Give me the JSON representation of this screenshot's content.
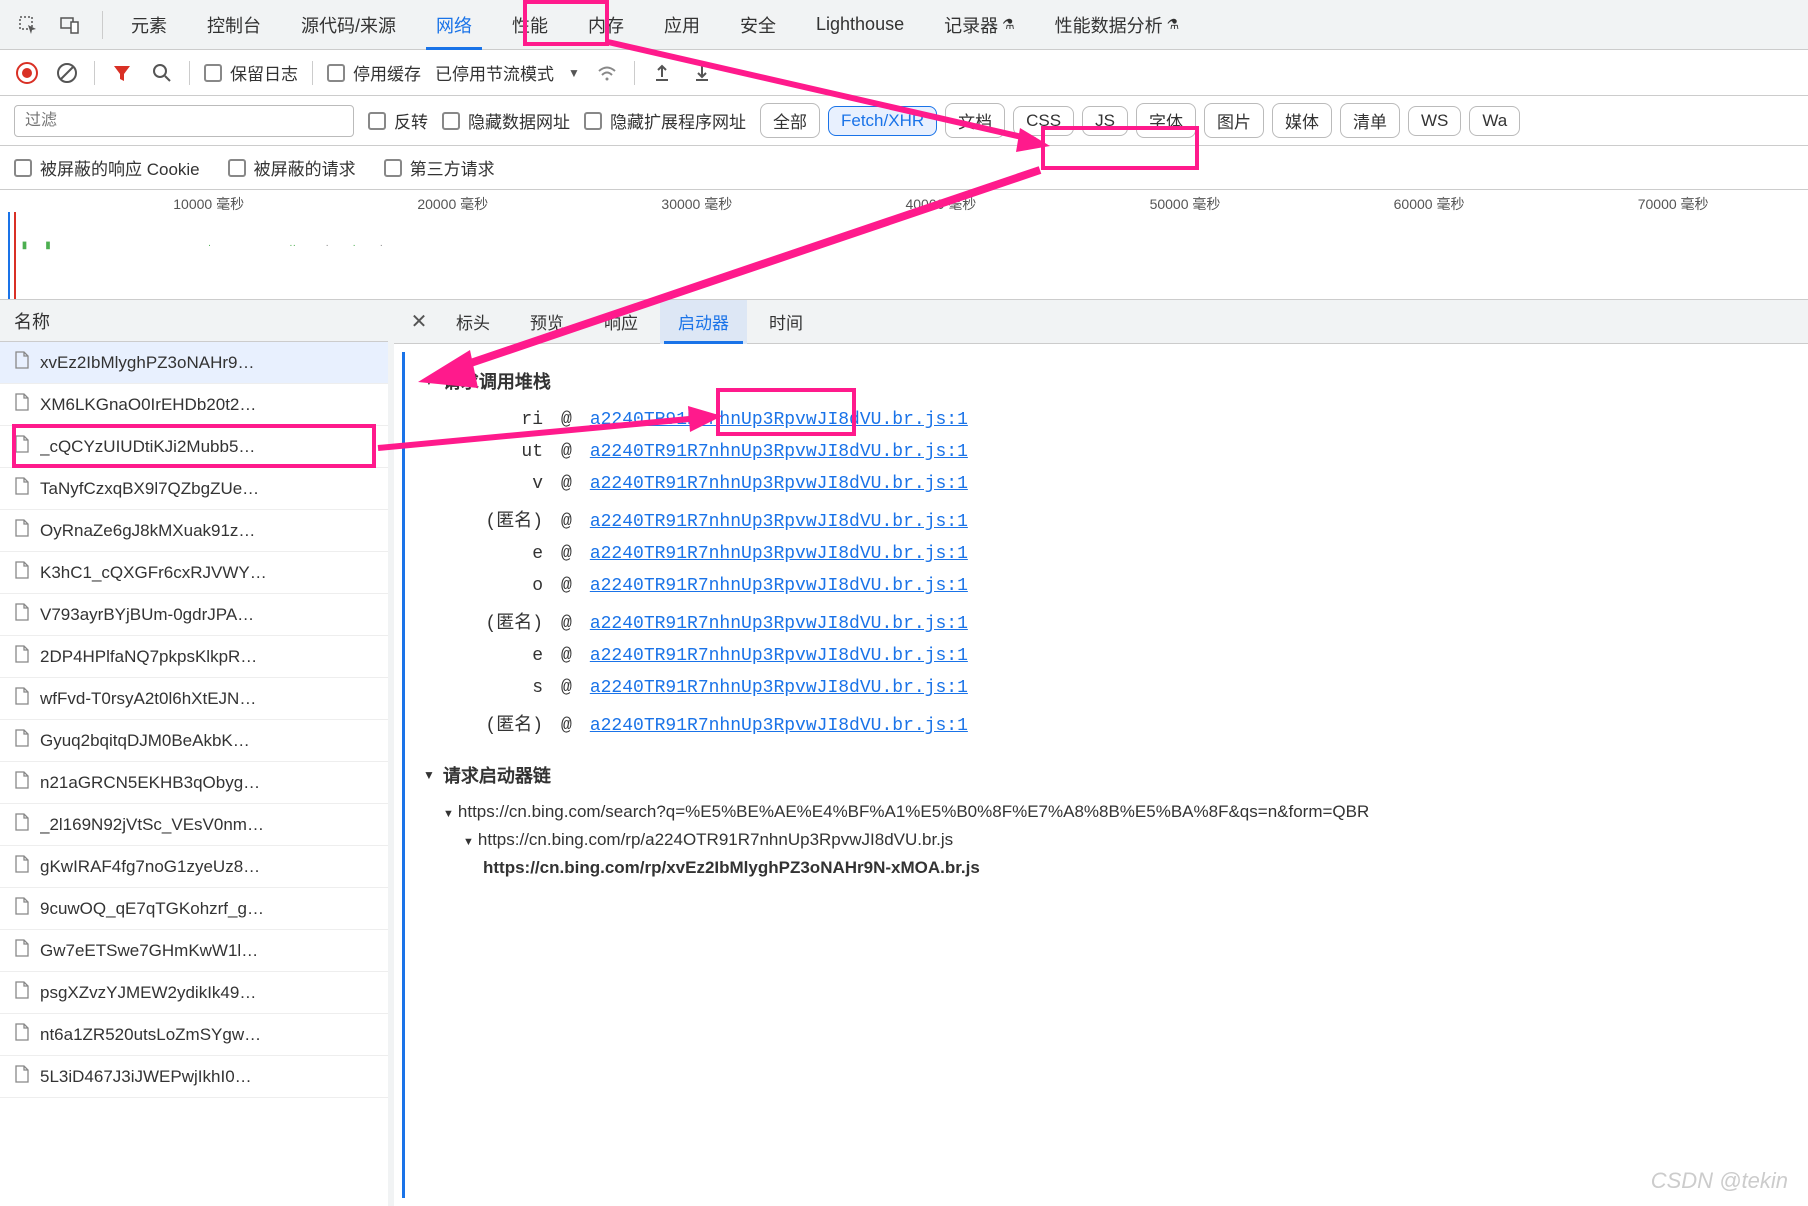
{
  "topTabs": {
    "items": [
      "元素",
      "控制台",
      "源代码/来源",
      "网络",
      "性能",
      "内存",
      "应用",
      "安全",
      "Lighthouse",
      "记录器",
      "性能数据分析"
    ],
    "activeIndex": 3,
    "betaIndices": [
      9,
      10
    ]
  },
  "toolbar2": {
    "preserveLog": "保留日志",
    "disableCache": "停用缓存",
    "throttling": "已停用节流模式"
  },
  "filterRow": {
    "placeholder": "过滤",
    "invert": "反转",
    "hideDataUrls": "隐藏数据网址",
    "hideExtUrls": "隐藏扩展程序网址",
    "pills": [
      "全部",
      "Fetch/XHR",
      "文档",
      "CSS",
      "JS",
      "字体",
      "图片",
      "媒体",
      "清单",
      "WS",
      "Wa"
    ],
    "activePillIndex": 1
  },
  "filterRow2": {
    "blockedCookies": "被屏蔽的响应 Cookie",
    "blockedRequests": "被屏蔽的请求",
    "thirdParty": "第三方请求"
  },
  "timeline": {
    "ticks": [
      "10000 毫秒",
      "20000 毫秒",
      "30000 毫秒",
      "40000 毫秒",
      "50000 毫秒",
      "60000 毫秒",
      "70000 毫秒"
    ]
  },
  "leftPane": {
    "header": "名称",
    "rows": [
      "xvEz2IbMlyghPZ3oNAHr9…",
      "XM6LKGnaO0IrEHDb20t2…",
      "_cQCYzUIUDtiKJi2Mubb5…",
      "TaNyfCzxqBX9l7QZbgZUe…",
      "OyRnaZe6gJ8kMXuak91z…",
      "K3hC1_cQXGFr6cxRJVWY…",
      "V793ayrBYjBUm-0gdrJPA…",
      "2DP4HPlfaNQ7pkpsKlkpR…",
      "wfFvd-T0rsyA2t0l6hXtEJN…",
      "Gyuq2bqitqDJM0BeAkbK…",
      "n21aGRCN5EKHB3qObyg…",
      "_2l169N92jVtSc_VEsV0nm…",
      "gKwIRAF4fg7noG1zyeUz8…",
      "9cuwOQ_qE7qTGKohzrf_g…",
      "Gw7eETSwe7GHmKwW1l…",
      "psgXZvzYJMEW2ydikIk49…",
      "nt6a1ZR520utsLoZmSYgw…",
      "5L3iD467J3iJWEPwjIkhI0…"
    ],
    "selectedIndex": 0
  },
  "detailTabs": {
    "items": [
      "标头",
      "预览",
      "响应",
      "启动器",
      "时间"
    ],
    "activeIndex": 3
  },
  "detail": {
    "stackTitle": "请求调用堆栈",
    "stackRows": [
      {
        "fn": "ri",
        "link": "a2240TR91R7nhnUp3RpvwJI8dVU.br.js:1"
      },
      {
        "fn": "ut",
        "link": "a2240TR91R7nhnUp3RpvwJI8dVU.br.js:1"
      },
      {
        "fn": "v",
        "link": "a2240TR91R7nhnUp3RpvwJI8dVU.br.js:1"
      },
      {
        "fn": "(匿名)",
        "link": "a2240TR91R7nhnUp3RpvwJI8dVU.br.js:1"
      },
      {
        "fn": "e",
        "link": "a2240TR91R7nhnUp3RpvwJI8dVU.br.js:1"
      },
      {
        "fn": "o",
        "link": "a2240TR91R7nhnUp3RpvwJI8dVU.br.js:1"
      },
      {
        "fn": "(匿名)",
        "link": "a2240TR91R7nhnUp3RpvwJI8dVU.br.js:1"
      },
      {
        "fn": "e",
        "link": "a2240TR91R7nhnUp3RpvwJI8dVU.br.js:1"
      },
      {
        "fn": "s",
        "link": "a2240TR91R7nhnUp3RpvwJI8dVU.br.js:1"
      },
      {
        "fn": "(匿名)",
        "link": "a2240TR91R7nhnUp3RpvwJI8dVU.br.js:1"
      }
    ],
    "at": "@",
    "chainTitle": "请求启动器链",
    "chain": [
      "https://cn.bing.com/search?q=%E5%BE%AE%E4%BF%A1%E5%B0%8F%E7%A8%8B%E5%BA%8F&qs=n&form=QBR",
      "https://cn.bing.com/rp/a224OTR91R7nhnUp3RpvwJI8dVU.br.js",
      "https://cn.bing.com/rp/xvEz2IbMlyghPZ3oNAHr9N-xMOA.br.js"
    ]
  },
  "watermark": "CSDN @tekin"
}
